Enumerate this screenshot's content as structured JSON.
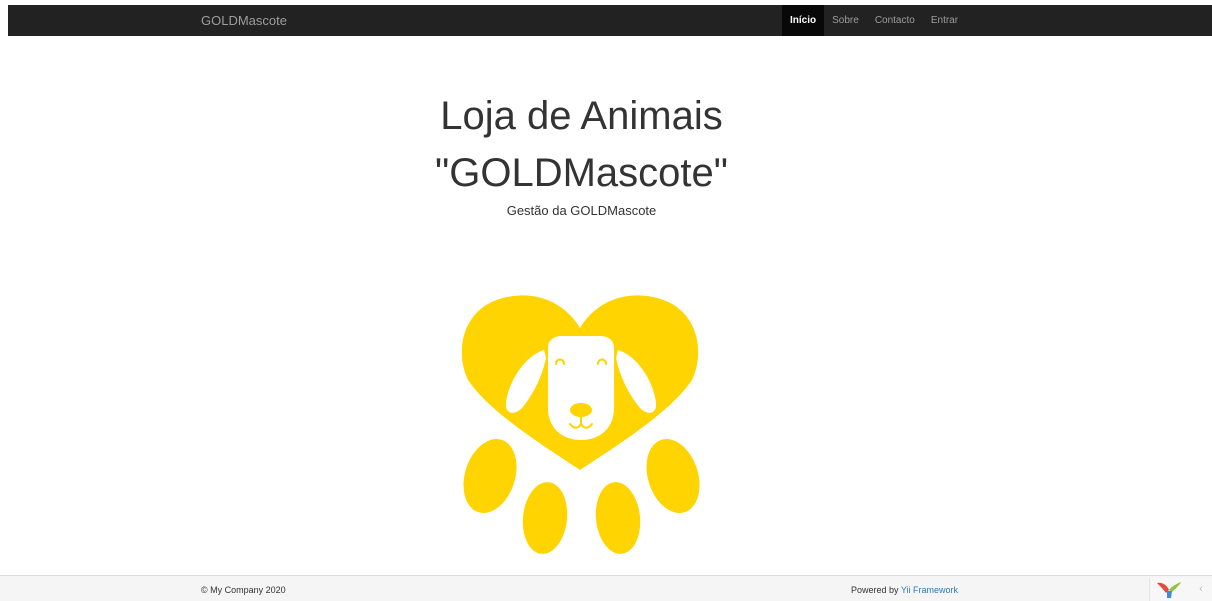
{
  "navbar": {
    "brand": "GOLDMascote",
    "items": [
      {
        "label": "Início",
        "active": true
      },
      {
        "label": "Sobre",
        "active": false
      },
      {
        "label": "Contacto",
        "active": false
      },
      {
        "label": "Entrar",
        "active": false
      }
    ]
  },
  "hero": {
    "title_line1": "Loja de Animais",
    "title_line2": "\"GOLDMascote\"",
    "lead": "Gestão da GOLDMascote"
  },
  "logo": {
    "icon": "dog-heart-paw-icon",
    "color": "#FFD400"
  },
  "footer": {
    "copyright": "© My Company 2020",
    "powered_prefix": "Powered by ",
    "powered_link": "Yii Framework"
  },
  "debug_toolbar": {
    "logo_icon": "yii-logo-icon",
    "toggle_glyph": "‹"
  },
  "colors": {
    "navbar_bg": "#222222",
    "navbar_active_bg": "#080808",
    "nav_text": "#9d9d9d",
    "logo_gold": "#FFD400",
    "link": "#337ab7",
    "footer_bg": "#f5f5f5"
  }
}
